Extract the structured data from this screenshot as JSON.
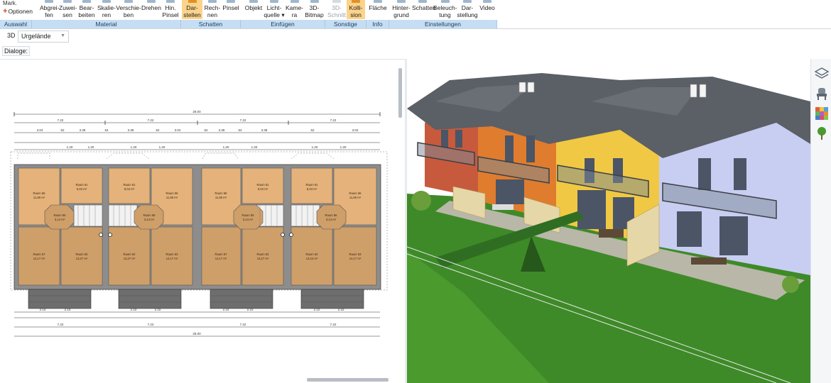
{
  "ribbon": {
    "auswahl": {
      "markier": "Mark.",
      "optionen": "Optionen",
      "title": "Auswahl"
    },
    "material": {
      "title": "Material",
      "tools": [
        {
          "l1": "Abgrei-",
          "l2": "fen"
        },
        {
          "l1": "Zuwei-",
          "l2": "sen"
        },
        {
          "l1": "Bear-",
          "l2": "beiten"
        },
        {
          "l1": "Skalie-",
          "l2": "ren"
        },
        {
          "l1": "Verschie-",
          "l2": "ben"
        },
        {
          "l1": "Drehen",
          "l2": ""
        },
        {
          "l1": "Hin.",
          "l2": "Pinsel"
        }
      ]
    },
    "schatten": {
      "title": "Schatten",
      "tools": [
        {
          "l1": "Dar-",
          "l2": "stellen"
        },
        {
          "l1": "Rech-",
          "l2": "nen"
        },
        {
          "l1": "Pinsel",
          "l2": ""
        }
      ]
    },
    "einfuegen": {
      "title": "Einfügen",
      "tools": [
        {
          "l1": "Objekt",
          "l2": ""
        },
        {
          "l1": "Licht-",
          "l2": "quelle ▾"
        },
        {
          "l1": "Kame-",
          "l2": "ra"
        },
        {
          "l1": "3D-",
          "l2": "Bitmap"
        }
      ]
    },
    "sonstige": {
      "title": "Sonstige",
      "tools": [
        {
          "l1": "3D-",
          "l2": "Schnitt"
        },
        {
          "l1": "Kolli-",
          "l2": "sion"
        }
      ]
    },
    "info": {
      "title": "Info",
      "tools": [
        {
          "l1": "Fläche",
          "l2": ""
        }
      ]
    },
    "einstellungen": {
      "title": "Einstellungen",
      "tools": [
        {
          "l1": "Hinter-",
          "l2": "grund"
        },
        {
          "l1": "Schatten",
          "l2": ""
        },
        {
          "l1": "Beleuch-",
          "l2": "tung"
        },
        {
          "l1": "Dar-",
          "l2": "stellung"
        },
        {
          "l1": "Video",
          "l2": ""
        }
      ]
    }
  },
  "viewbar": {
    "mode": "3D",
    "terrain": "Urgelände",
    "dialog_label": "Dialoge:"
  },
  "plan": {
    "dims_top": {
      "total": "28.00",
      "segments": [
        "7.22",
        "7.22",
        "7.22",
        "7.22"
      ],
      "sub": [
        "3.04",
        "62",
        "3.38",
        "54",
        "3.38",
        "62",
        "3.04",
        "62",
        "3.38",
        "54",
        "3.38",
        "62",
        "3.04"
      ],
      "minor": [
        "1.20",
        "1.20",
        "1.20",
        "1.20",
        "1.20",
        "1.20",
        "1.20",
        "1.20"
      ]
    },
    "dims_bottom": {
      "total": "28.00",
      "segments": [
        "7.22",
        "7.22",
        "7.22",
        "7.22"
      ],
      "sub": [
        "2.10",
        "2.10",
        "2.10",
        "2.10",
        "2.10",
        "2.10",
        "2.10",
        "2.10"
      ]
    },
    "rooms": [
      {
        "name": "Raum 66",
        "area": "11,86 m²"
      },
      {
        "name": "Raum 61",
        "area": "6,04 m²"
      },
      {
        "name": "Raum 61",
        "area": "6,04 m²"
      },
      {
        "name": "Raum 66",
        "area": "11,86 m²"
      },
      {
        "name": "Raum 66",
        "area": "11,86 m²"
      },
      {
        "name": "Raum 61",
        "area": "6,04 m²"
      },
      {
        "name": "Raum 61",
        "area": "6,04 m²"
      },
      {
        "name": "Raum 66",
        "area": "11,86 m²"
      },
      {
        "name": "Raum 65",
        "area": "3,14 m²"
      },
      {
        "name": "Raum 65",
        "area": "3,14 m²"
      },
      {
        "name": "Raum 65",
        "area": "3,14 m²"
      },
      {
        "name": "Raum 65",
        "area": "3,14 m²"
      },
      {
        "name": "Raum 67",
        "area": "14,17 m²"
      },
      {
        "name": "Raum 62",
        "area": "13,27 m²"
      },
      {
        "name": "Raum 62",
        "area": "13,27 m²"
      },
      {
        "name": "Raum 63",
        "area": "14,17 m²"
      },
      {
        "name": "Raum 67",
        "area": "14,17 m²"
      },
      {
        "name": "Raum 62",
        "area": "13,27 m²"
      },
      {
        "name": "Raum 62",
        "area": "13,24 m²"
      },
      {
        "name": "Raum 63",
        "area": "14,17 m²"
      }
    ]
  },
  "colors": {
    "ribbon_group": "#c6def3",
    "active_tool": "#fbd38a",
    "wood_floor": "#e2b27a",
    "grass": "#3f8a2a",
    "roof": "#5c6066"
  },
  "side_tools": [
    "layers-icon",
    "chair-icon",
    "palette-icon",
    "tree-icon"
  ]
}
